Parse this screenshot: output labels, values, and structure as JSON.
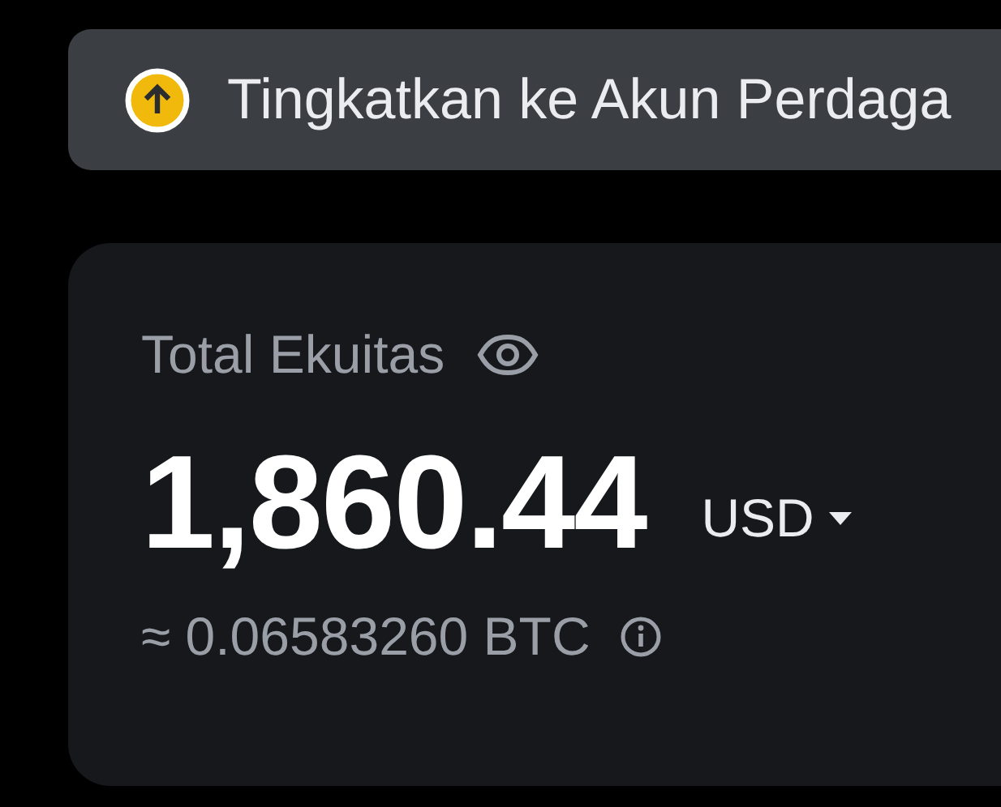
{
  "upgrade_banner": {
    "text": "Tingkatkan ke Akun Perdaga"
  },
  "equity_card": {
    "label": "Total Ekuitas",
    "amount": "1,860.44",
    "currency": "USD",
    "btc_equivalent": "≈ 0.06583260 BTC"
  }
}
